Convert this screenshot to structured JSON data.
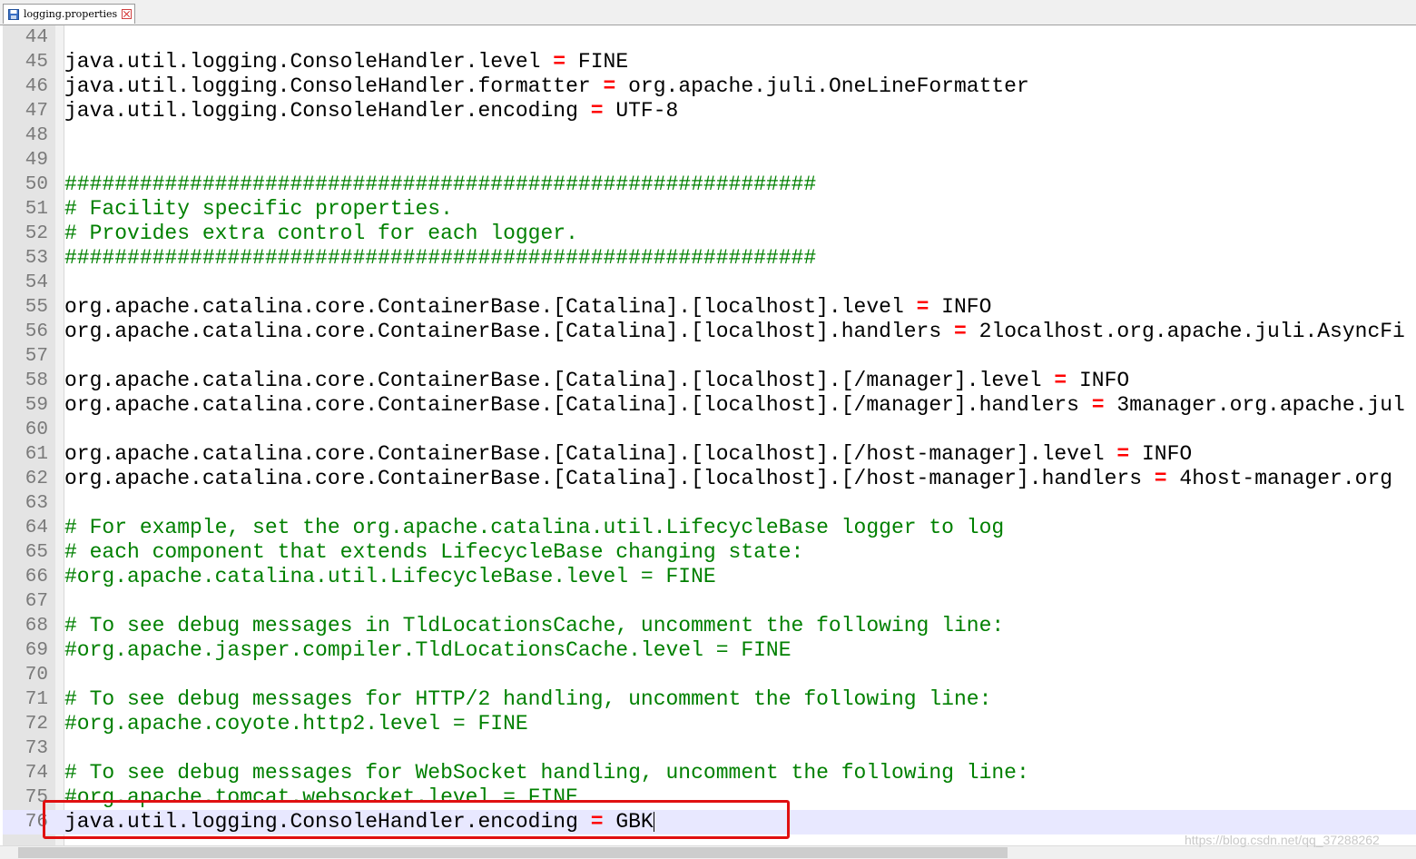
{
  "tab": {
    "title": "logging.properties",
    "icon": "save-icon",
    "close_icon": "close-icon"
  },
  "colors": {
    "comment": "#008000",
    "operator": "#ff0000",
    "current_line": "#e8e8ff",
    "highlight_box": "#e01010"
  },
  "editor": {
    "lines": [
      {
        "n": "44",
        "type": "blank",
        "text": ""
      },
      {
        "n": "45",
        "type": "kv",
        "key": "java.util.logging.ConsoleHandler.level ",
        "op": "=",
        "value": " FINE"
      },
      {
        "n": "46",
        "type": "kv",
        "key": "java.util.logging.ConsoleHandler.formatter ",
        "op": "=",
        "value": " org.apache.juli.OneLineFormatter"
      },
      {
        "n": "47",
        "type": "kv",
        "key": "java.util.logging.ConsoleHandler.encoding ",
        "op": "=",
        "value": " UTF-8"
      },
      {
        "n": "48",
        "type": "blank",
        "text": ""
      },
      {
        "n": "49",
        "type": "blank",
        "text": ""
      },
      {
        "n": "50",
        "type": "comment",
        "text": "############################################################"
      },
      {
        "n": "51",
        "type": "comment",
        "text": "# Facility specific properties."
      },
      {
        "n": "52",
        "type": "comment",
        "text": "# Provides extra control for each logger."
      },
      {
        "n": "53",
        "type": "comment",
        "text": "############################################################"
      },
      {
        "n": "54",
        "type": "blank",
        "text": ""
      },
      {
        "n": "55",
        "type": "kv",
        "key": "org.apache.catalina.core.ContainerBase.[Catalina].[localhost].level ",
        "op": "=",
        "value": " INFO"
      },
      {
        "n": "56",
        "type": "kv",
        "key": "org.apache.catalina.core.ContainerBase.[Catalina].[localhost].handlers ",
        "op": "=",
        "value": " 2localhost.org.apache.juli.AsyncFi"
      },
      {
        "n": "57",
        "type": "blank",
        "text": ""
      },
      {
        "n": "58",
        "type": "kv",
        "key": "org.apache.catalina.core.ContainerBase.[Catalina].[localhost].[/manager].level ",
        "op": "=",
        "value": " INFO"
      },
      {
        "n": "59",
        "type": "kv",
        "key": "org.apache.catalina.core.ContainerBase.[Catalina].[localhost].[/manager].handlers ",
        "op": "=",
        "value": " 3manager.org.apache.jul"
      },
      {
        "n": "60",
        "type": "blank",
        "text": ""
      },
      {
        "n": "61",
        "type": "kv",
        "key": "org.apache.catalina.core.ContainerBase.[Catalina].[localhost].[/host-manager].level ",
        "op": "=",
        "value": " INFO"
      },
      {
        "n": "62",
        "type": "kv",
        "key": "org.apache.catalina.core.ContainerBase.[Catalina].[localhost].[/host-manager].handlers ",
        "op": "=",
        "value": " 4host-manager.org"
      },
      {
        "n": "63",
        "type": "blank",
        "text": ""
      },
      {
        "n": "64",
        "type": "comment",
        "text": "# For example, set the org.apache.catalina.util.LifecycleBase logger to log"
      },
      {
        "n": "65",
        "type": "comment",
        "text": "# each component that extends LifecycleBase changing state:"
      },
      {
        "n": "66",
        "type": "comment",
        "text": "#org.apache.catalina.util.LifecycleBase.level = FINE"
      },
      {
        "n": "67",
        "type": "blank",
        "text": ""
      },
      {
        "n": "68",
        "type": "comment",
        "text": "# To see debug messages in TldLocationsCache, uncomment the following line:"
      },
      {
        "n": "69",
        "type": "comment",
        "text": "#org.apache.jasper.compiler.TldLocationsCache.level = FINE"
      },
      {
        "n": "70",
        "type": "blank",
        "text": ""
      },
      {
        "n": "71",
        "type": "comment",
        "text": "# To see debug messages for HTTP/2 handling, uncomment the following line:"
      },
      {
        "n": "72",
        "type": "comment",
        "text": "#org.apache.coyote.http2.level = FINE"
      },
      {
        "n": "73",
        "type": "blank",
        "text": ""
      },
      {
        "n": "74",
        "type": "comment",
        "text": "# To see debug messages for WebSocket handling, uncomment the following line:"
      },
      {
        "n": "75",
        "type": "comment",
        "text": "#org.apache.tomcat.websocket.level = FINE"
      },
      {
        "n": "76",
        "type": "kv",
        "key": "java.util.logging.ConsoleHandler.encoding ",
        "op": "=",
        "value": " GBK",
        "current": true
      }
    ]
  },
  "watermark": "https://blog.csdn.net/qq_37288262"
}
